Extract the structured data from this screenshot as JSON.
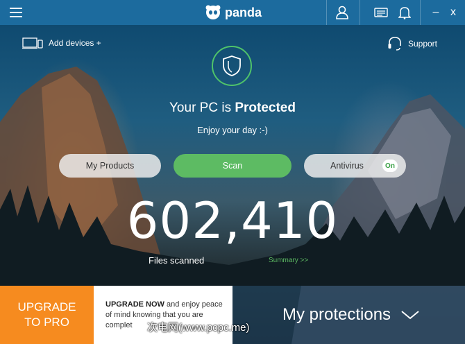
{
  "header": {
    "brand": "panda",
    "icons": [
      "hamburger-icon",
      "user-icon",
      "news-icon",
      "bell-icon"
    ],
    "minimize": "–",
    "close": "x"
  },
  "top": {
    "add_devices": "Add devices +",
    "support": "Support"
  },
  "status": {
    "prefix": "Your PC is",
    "state": "Protected",
    "subtitle": "Enjoy your day :-)"
  },
  "buttons": {
    "my_products": "My Products",
    "scan": "Scan",
    "antivirus": "Antivirus",
    "antivirus_toggle": "On"
  },
  "stats": {
    "files_scanned_count": "602,410",
    "files_scanned_label": "Files scanned",
    "summary_link": "Summary >>"
  },
  "bottom": {
    "upgrade_button": "UPGRADE TO PRO",
    "upgrade_bold": "UPGRADE NOW",
    "upgrade_text": " and enjoy peace of mind knowing that you are complet",
    "protections": "My protections"
  },
  "watermark": "次电网(www.pcpc.me)",
  "colors": {
    "titlebar": "#1c6b9e",
    "accent_green": "#5dbb63",
    "upgrade_orange": "#f68b1f"
  }
}
